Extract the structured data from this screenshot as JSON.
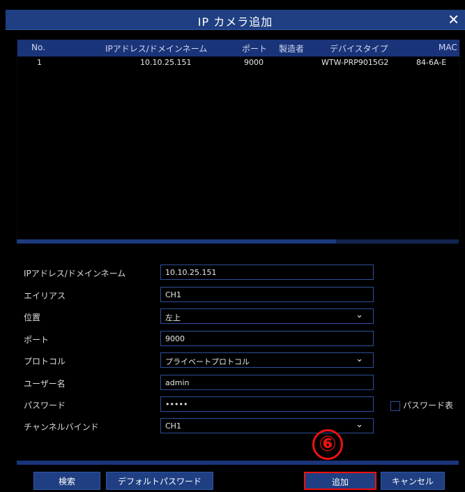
{
  "dialog": {
    "title": "IP カメラ追加",
    "close_icon": "close-icon"
  },
  "table": {
    "headers": [
      "No.",
      "IPアドレス/ドメインネーム",
      "ポート",
      "製造者",
      "デバイスタイプ",
      "MAC"
    ],
    "rows": [
      {
        "no": "1",
        "ip": "10.10.25.151",
        "port": "9000",
        "manufacturer": "",
        "device_type": "WTW-PRP9015G2",
        "mac": "84-6A-E"
      }
    ]
  },
  "form": {
    "ip_label": "IPアドレス/ドメインネーム",
    "ip_value": "10.10.25.151",
    "alias_label": "エイリアス",
    "alias_value": "CH1",
    "position_label": "位置",
    "position_value": "左上",
    "port_label": "ポート",
    "port_value": "9000",
    "protocol_label": "プロトコル",
    "protocol_value": "プライベートプロトコル",
    "username_label": "ユーザー名",
    "username_value": "admin",
    "password_label": "パスワード",
    "password_value": "•••••",
    "show_password_label": "パスワード表",
    "channel_bind_label": "チャンネルバインド",
    "channel_bind_value": "CH1"
  },
  "buttons": {
    "search": "検索",
    "default_password": "デフォルトパスワード",
    "add": "追加",
    "cancel": "キャンセル"
  },
  "annotation": {
    "step_marker": "⑥"
  },
  "colors": {
    "header_blue": "#1a347a",
    "button_blue": "#1f3f82",
    "highlight_red": "#e11"
  }
}
